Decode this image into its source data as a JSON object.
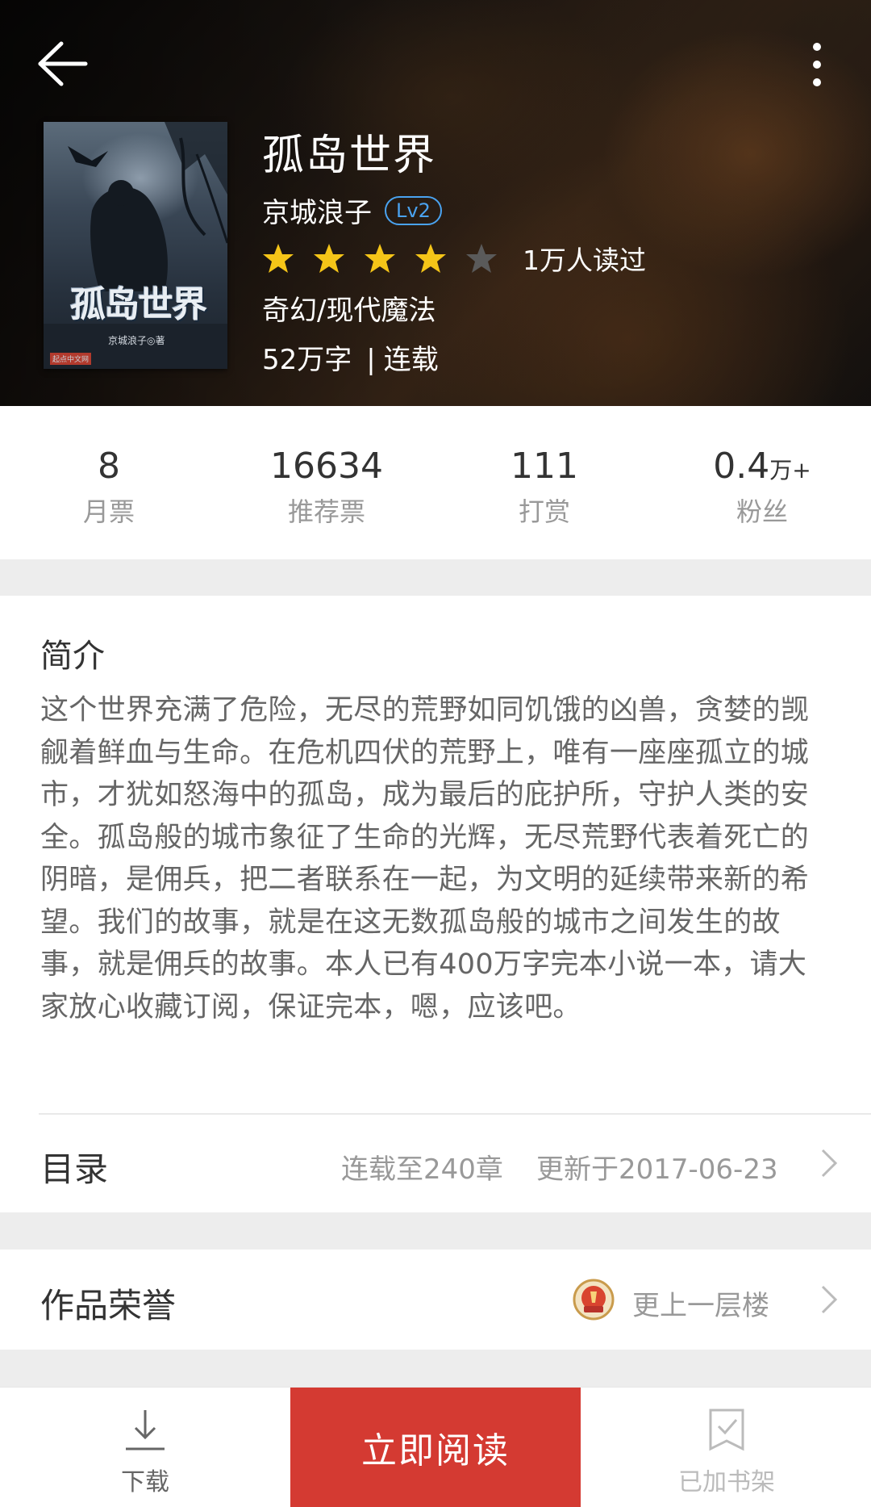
{
  "book": {
    "title": "孤岛世界",
    "author": "京城浪子",
    "author_level": "Lv2",
    "rating_stars": 4,
    "rating_max": 5,
    "readers": "1万人读过",
    "genre": "奇幻/现代魔法",
    "word_count": "52万字",
    "status_separator": "|",
    "status": "连载",
    "cover": {
      "title": "孤岛世界",
      "author": "京城浪子◎著",
      "publisher": "起点中文网"
    }
  },
  "stats": [
    {
      "value": "8",
      "unit": "",
      "label": "月票"
    },
    {
      "value": "16634",
      "unit": "",
      "label": "推荐票"
    },
    {
      "value": "111",
      "unit": "",
      "label": "打赏"
    },
    {
      "value": "0.4",
      "unit": "万+",
      "label": "粉丝"
    }
  ],
  "intro": {
    "heading": "简介",
    "text": "这个世界充满了危险，无尽的荒野如同饥饿的凶兽，贪婪的觊觎着鲜血与生命。在危机四伏的荒野上，唯有一座座孤立的城市，才犹如怒海中的孤岛，成为最后的庇护所，守护人类的安全。孤岛般的城市象征了生命的光辉，无尽荒野代表着死亡的阴暗，是佣兵，把二者联系在一起，为文明的延续带来新的希望。我们的故事，就是在这无数孤岛般的城市之间发生的故事，就是佣兵的故事。本人已有400万字完本小说一本，请大家放心收藏订阅，保证完本，嗯，应该吧。"
  },
  "toc": {
    "label": "目录",
    "progress": "连载至240章",
    "updated": "更新于2017-06-23"
  },
  "honor": {
    "label": "作品荣誉",
    "value": "更上一层楼",
    "badge_text": "更上一层楼"
  },
  "bottom_bar": {
    "download_label": "下载",
    "read_label": "立即阅读",
    "shelf_label": "已加书架"
  },
  "colors": {
    "accent_red": "#d43a32",
    "star_gold": "#f5c518",
    "level_blue": "#4aa3f0"
  }
}
